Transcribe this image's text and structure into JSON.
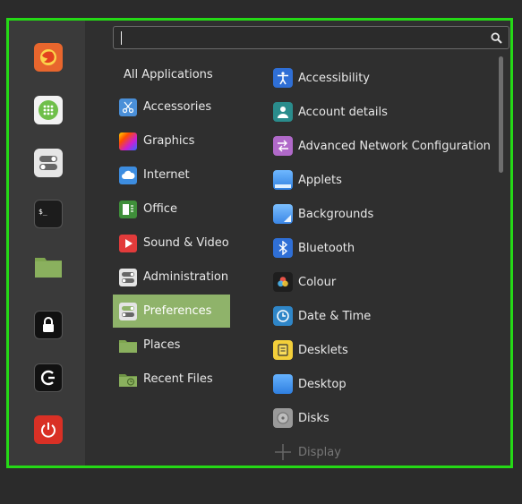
{
  "search": {
    "value": "",
    "placeholder": ""
  },
  "favorites": [
    {
      "name": "firefox-icon",
      "color": "#e8662d"
    },
    {
      "name": "software-manager-icon",
      "color": "#f2f2f2"
    },
    {
      "name": "settings-icon",
      "color": "#e6e6e6"
    },
    {
      "name": "terminal-icon",
      "color": "#1c1c1c"
    },
    {
      "name": "files-icon",
      "color": "#8ab05e"
    },
    {
      "name": "lock-screen-icon",
      "color": "#111111"
    },
    {
      "name": "logout-icon",
      "color": "#111111"
    },
    {
      "name": "shutdown-icon",
      "color": "#d93025"
    }
  ],
  "categories": [
    {
      "label": "All Applications"
    },
    {
      "label": "Accessories",
      "icon": "scissors-icon"
    },
    {
      "label": "Graphics",
      "icon": "graphics-icon"
    },
    {
      "label": "Internet",
      "icon": "cloud-icon"
    },
    {
      "label": "Office",
      "icon": "office-icon"
    },
    {
      "label": "Sound & Video",
      "icon": "play-icon"
    },
    {
      "label": "Administration",
      "icon": "toggles-icon"
    },
    {
      "label": "Preferences",
      "icon": "preferences-icon",
      "selected": true
    },
    {
      "label": "Places",
      "icon": "folder-icon"
    },
    {
      "label": "Recent Files",
      "icon": "recent-folder-icon"
    }
  ],
  "apps": [
    {
      "label": "Accessibility",
      "icon": "accessibility-icon"
    },
    {
      "label": "Account details",
      "icon": "account-icon"
    },
    {
      "label": "Advanced Network Configuration",
      "icon": "network-icon"
    },
    {
      "label": "Applets",
      "icon": "applets-icon"
    },
    {
      "label": "Backgrounds",
      "icon": "backgrounds-icon"
    },
    {
      "label": "Bluetooth",
      "icon": "bluetooth-icon"
    },
    {
      "label": "Colour",
      "icon": "colour-icon"
    },
    {
      "label": "Date & Time",
      "icon": "clock-icon"
    },
    {
      "label": "Desklets",
      "icon": "desklets-icon"
    },
    {
      "label": "Desktop",
      "icon": "desktop-icon"
    },
    {
      "label": "Disks",
      "icon": "disks-icon"
    },
    {
      "label": "Display",
      "icon": "display-icon"
    }
  ],
  "colors": {
    "accent": "#8fb36a",
    "frame": "#25d916"
  }
}
